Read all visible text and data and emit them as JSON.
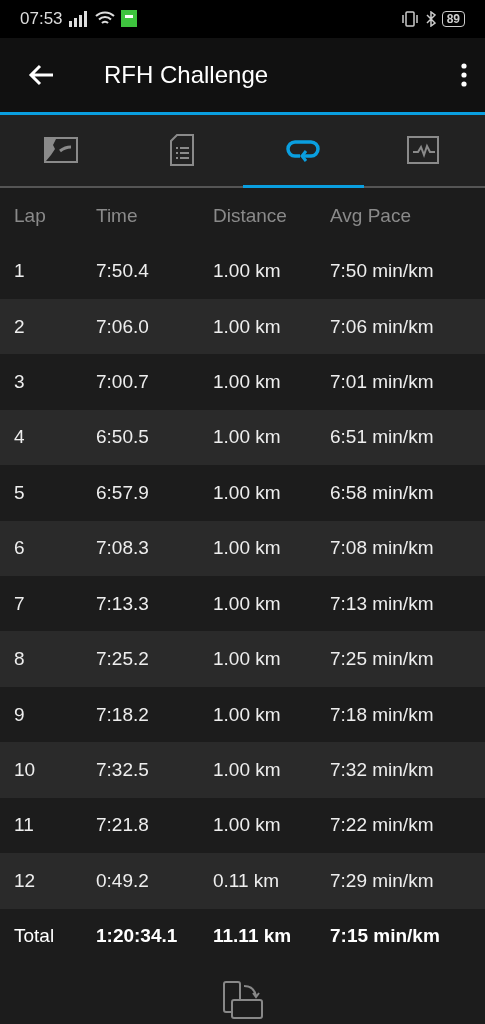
{
  "status_bar": {
    "time": "07:53",
    "battery": "89"
  },
  "app_bar": {
    "title": "RFH Challenge"
  },
  "tabs": [
    {
      "selected": false
    },
    {
      "selected": false
    },
    {
      "selected": true
    },
    {
      "selected": false
    }
  ],
  "table": {
    "columns": [
      "Lap",
      "Time",
      "Distance",
      "Avg Pace"
    ],
    "rows": [
      [
        "1",
        "7:50.4",
        "1.00 km",
        "7:50 min/km"
      ],
      [
        "2",
        "7:06.0",
        "1.00 km",
        "7:06 min/km"
      ],
      [
        "3",
        "7:00.7",
        "1.00 km",
        "7:01 min/km"
      ],
      [
        "4",
        "6:50.5",
        "1.00 km",
        "6:51 min/km"
      ],
      [
        "5",
        "6:57.9",
        "1.00 km",
        "6:58 min/km"
      ],
      [
        "6",
        "7:08.3",
        "1.00 km",
        "7:08 min/km"
      ],
      [
        "7",
        "7:13.3",
        "1.00 km",
        "7:13 min/km"
      ],
      [
        "8",
        "7:25.2",
        "1.00 km",
        "7:25 min/km"
      ],
      [
        "9",
        "7:18.2",
        "1.00 km",
        "7:18 min/km"
      ],
      [
        "10",
        "7:32.5",
        "1.00 km",
        "7:32 min/km"
      ],
      [
        "11",
        "7:21.8",
        "1.00 km",
        "7:22 min/km"
      ],
      [
        "12",
        "0:49.2",
        "0.11 km",
        "7:29 min/km"
      ]
    ],
    "total": [
      "Total",
      "1:20:34.1",
      "11.11 km",
      "7:15 min/km"
    ]
  }
}
